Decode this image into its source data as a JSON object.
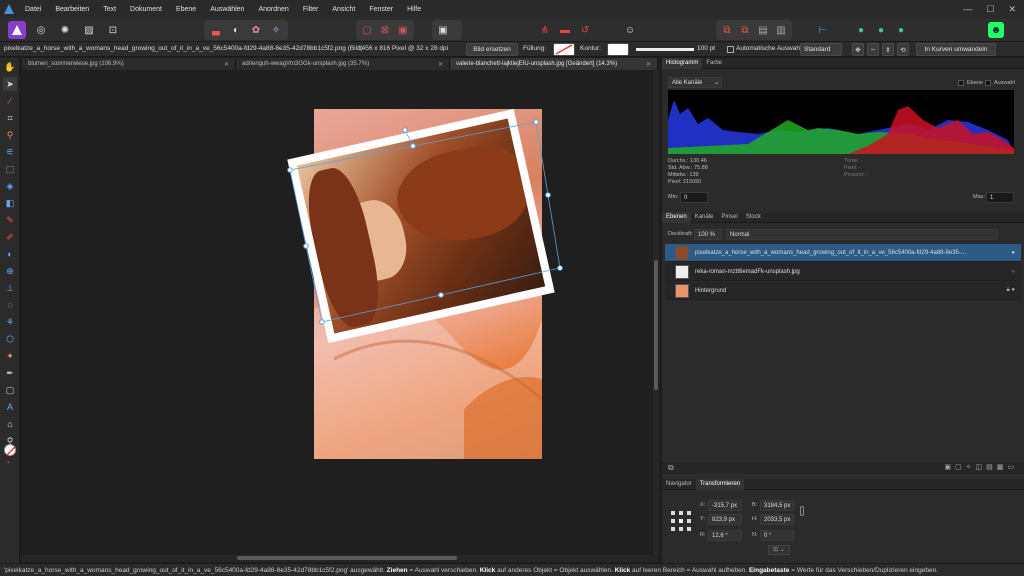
{
  "menu": [
    "Datei",
    "Bearbeiten",
    "Text",
    "Dokument",
    "Ebene",
    "Auswählen",
    "Anordnen",
    "Filter",
    "Ansicht",
    "Fenster",
    "Hilfe"
  ],
  "window_controls": {
    "minimize": "—",
    "maximize": "☐",
    "close": "✕"
  },
  "context": {
    "file_name": "pixelkatze_a_horse_with_a_womans_head_growing_out_of_it_in_a_ve_56c5400a-fd29-4a88-8e35-42d78bb1c5f2.png (Bild)",
    "dimensions": "1456 x 816 Pixel @ 32 x 28 dpi",
    "replace_label": "Bild ersetzen",
    "fill_label": "Füllung:",
    "stroke_label": "Kontur:",
    "stroke_width": "100 pt",
    "auto_select_label": "Automatische Auswahl",
    "mode_value": "Standard",
    "convert_label": "In Kurven umwandeln"
  },
  "tabs": [
    {
      "label": "blumen_sommerwiese.jpg (106.9%)"
    },
    {
      "label": "adrienguh-wwagVtn3GGk-unsplash.jpg (35.7%)"
    },
    {
      "label": "valerie-blanchett-lajktiejEIU-unsplash.jpg [Geändert] (14.3%)"
    }
  ],
  "histogram": {
    "tabs": [
      "Histogramm",
      "Farbe"
    ],
    "channel": "Alle Kanäle",
    "layer_label": "Ebene",
    "selection_label": "Auswahl",
    "stats_left": [
      "Durchs.: 130.46",
      "Std. Abw.: 75.88",
      "Mittelw.: 139",
      "Pixel: 215050"
    ],
    "stats_right": [
      "Tonw.: -",
      "Pixel: -",
      "Prozent: -"
    ],
    "min_label": "Min:",
    "min_value": "0",
    "max_label": "Max:",
    "max_value": "1"
  },
  "layers": {
    "tabs": [
      "Ebenen",
      "Kanäle",
      "Pinsel",
      "Stock"
    ],
    "opacity_label": "Deckkraft:",
    "opacity_value": "100 %",
    "blend_mode": "Normal",
    "items": [
      {
        "name": "pixelkatze_a_horse_with_a_womans_head_growing_out_of_it_in_a_ve_56c5400a-fd29-4a88-8e35-..."
      },
      {
        "name": "reka-roman-mztt6emadFk-unsplash.jpg"
      },
      {
        "name": "Hintergrund"
      }
    ]
  },
  "transform": {
    "tabs": [
      "Navigator",
      "Transformieren"
    ],
    "x_label": "X:",
    "x": "-315,7 px",
    "y_label": "Y:",
    "y": "823,9 px",
    "w_label": "B:",
    "w": "3184,5 px",
    "h_label": "H:",
    "h": "2033,5 px",
    "r_label": "R:",
    "r": "12,6 °",
    "s_label": "N:",
    "s": "0 °"
  },
  "status": {
    "file": "'pixelkatze_a_horse_with_a_womans_head_growing_out_of_it_in_a_ve_56c5400a-fd29-4a88-8e35-42d78bb1c5f2.png'",
    "t1": " ausgewählt. ",
    "k1": "Ziehen",
    "t2": " = Auswahl verschieben. ",
    "k2": "Klick",
    "t3": " auf anderes Objekt = Objekt auswählen. ",
    "k3": "Klick",
    "t4": " auf leeren Bereich = Auswahl aufheben. ",
    "k4": "Eingabetaste",
    "t5": " = Werte für das Verschieben/Duplizieren eingeben."
  }
}
